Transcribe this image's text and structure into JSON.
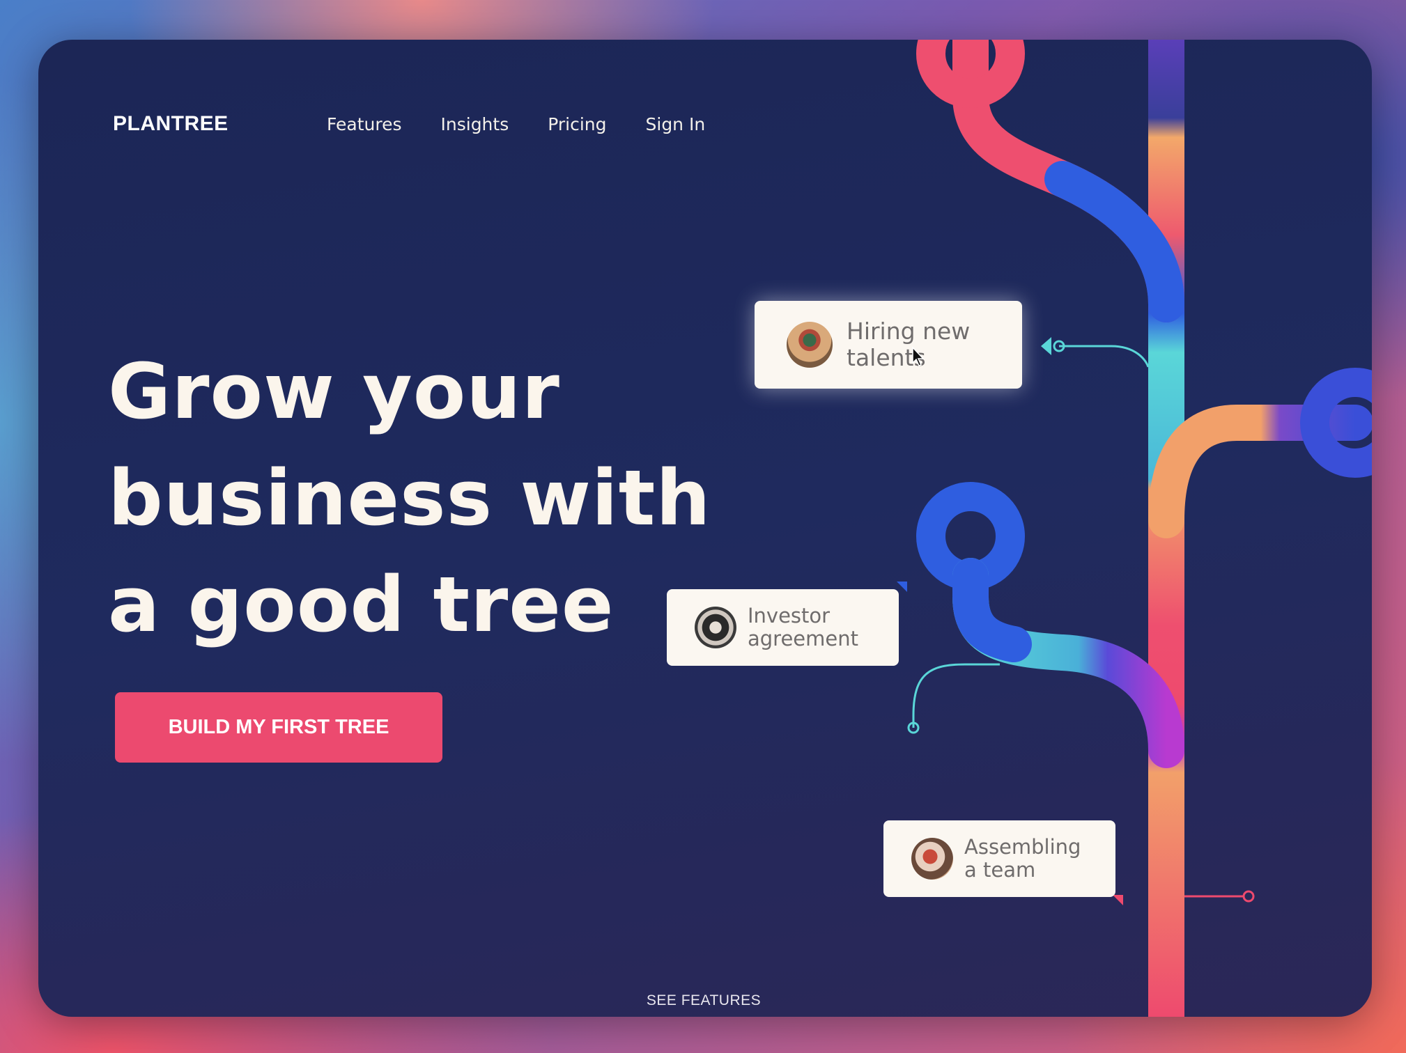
{
  "brand": {
    "logo": "PLANTREE"
  },
  "nav": {
    "items": [
      "Features",
      "Insights",
      "Pricing",
      "Sign In"
    ]
  },
  "hero": {
    "headline_lines": [
      "Grow your",
      "business with",
      "a good tree"
    ],
    "cta_label": "BUILD MY FIRST TREE"
  },
  "tree_cards": [
    {
      "line1": "Hiring new",
      "line2": "talents",
      "avatar": "person-avatar"
    },
    {
      "line1": "Investor",
      "line2": "agreement",
      "avatar": "group-avatar"
    },
    {
      "line1": "Assembling",
      "line2": "a team",
      "avatar": "team-avatar"
    }
  ],
  "footer": {
    "see_features": "SEE FEATURES",
    "arrow_icon": "chevron-down-icon"
  },
  "colors": {
    "card_bg": "#1f2a5e",
    "accent_pink": "#ec4a6f",
    "accent_blue": "#2f5ee0",
    "accent_cyan": "#5ad6d8",
    "accent_orange": "#f4a06a",
    "text_light": "#fbf5ec"
  }
}
